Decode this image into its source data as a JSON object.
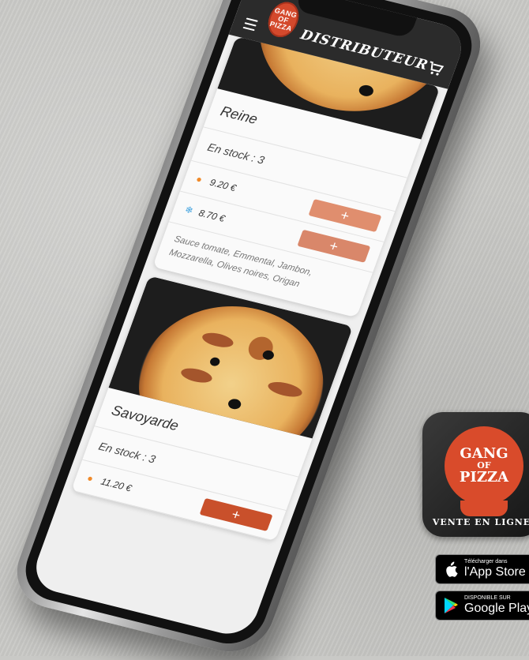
{
  "app": {
    "title": "DISTRIBUTEUR",
    "logo_text": [
      "GANG",
      "OF",
      "PIZZA"
    ],
    "accent": "#d4492c"
  },
  "products": [
    {
      "name": "Reine",
      "stock": "En stock : 3",
      "prices": [
        {
          "icon": "flame-icon",
          "glyph": "●",
          "color": "#f08a2a",
          "value": "9.20 €",
          "button": "+",
          "button_color": "#e08e6e"
        },
        {
          "icon": "snowflake-icon",
          "glyph": "❄",
          "color": "#46a5e0",
          "value": "8.70 €",
          "button": "+",
          "button_color": "#d9876a"
        }
      ],
      "description": "Sauce tomate, Emmental, Jambon, Mozzarella, Olives noires, Origan"
    },
    {
      "name": "Savoyarde",
      "stock": "En stock : 3",
      "prices": [
        {
          "icon": "flame-icon",
          "glyph": "●",
          "color": "#f08a2a",
          "value": "11.20 €",
          "button": "+",
          "button_color": "#c9502b"
        }
      ]
    }
  ],
  "app_icon": {
    "seal_text": [
      "GANG",
      "OF",
      "PIZZA"
    ],
    "caption": "VENTE EN LIGNE"
  },
  "stores": [
    {
      "icon": "apple-icon",
      "small": "Télécharger dans",
      "big": "l'App Store"
    },
    {
      "icon": "google-play-icon",
      "small": "DISPONIBLE SUR",
      "big": "Google Play"
    }
  ]
}
